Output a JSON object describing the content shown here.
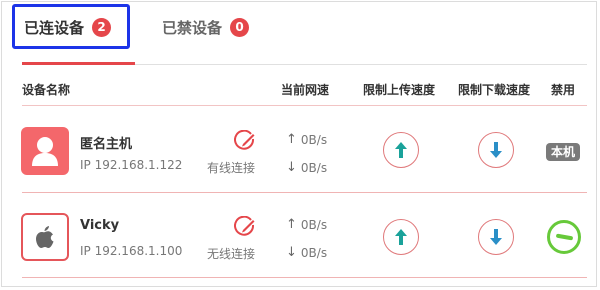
{
  "tabs": {
    "connected": {
      "label": "已连设备",
      "count": "2"
    },
    "blocked": {
      "label": "已禁设备",
      "count": "0"
    }
  },
  "headers": {
    "device_name": "设备名称",
    "current_speed": "当前网速",
    "limit_upload": "限制上传速度",
    "limit_download": "限制下载速度",
    "ban": "禁用"
  },
  "devices": [
    {
      "name": "匿名主机",
      "ip": "IP 192.168.1.122",
      "connection": "有线连接",
      "upload_speed": "0B/s",
      "download_speed": "0B/s",
      "ban_label": "本机",
      "avatar_icon": "user-icon"
    },
    {
      "name": "Vicky",
      "ip": "IP 192.168.1.100",
      "connection": "无线连接",
      "upload_speed": "0B/s",
      "download_speed": "0B/s",
      "avatar_icon": "apple-icon"
    }
  ],
  "colors": {
    "accent_red": "#e5464a",
    "highlight_blue": "#1c34e8",
    "upload_arrow": "#1aa29a",
    "download_arrow": "#2a8fc7",
    "ban_green": "#67c93a"
  }
}
